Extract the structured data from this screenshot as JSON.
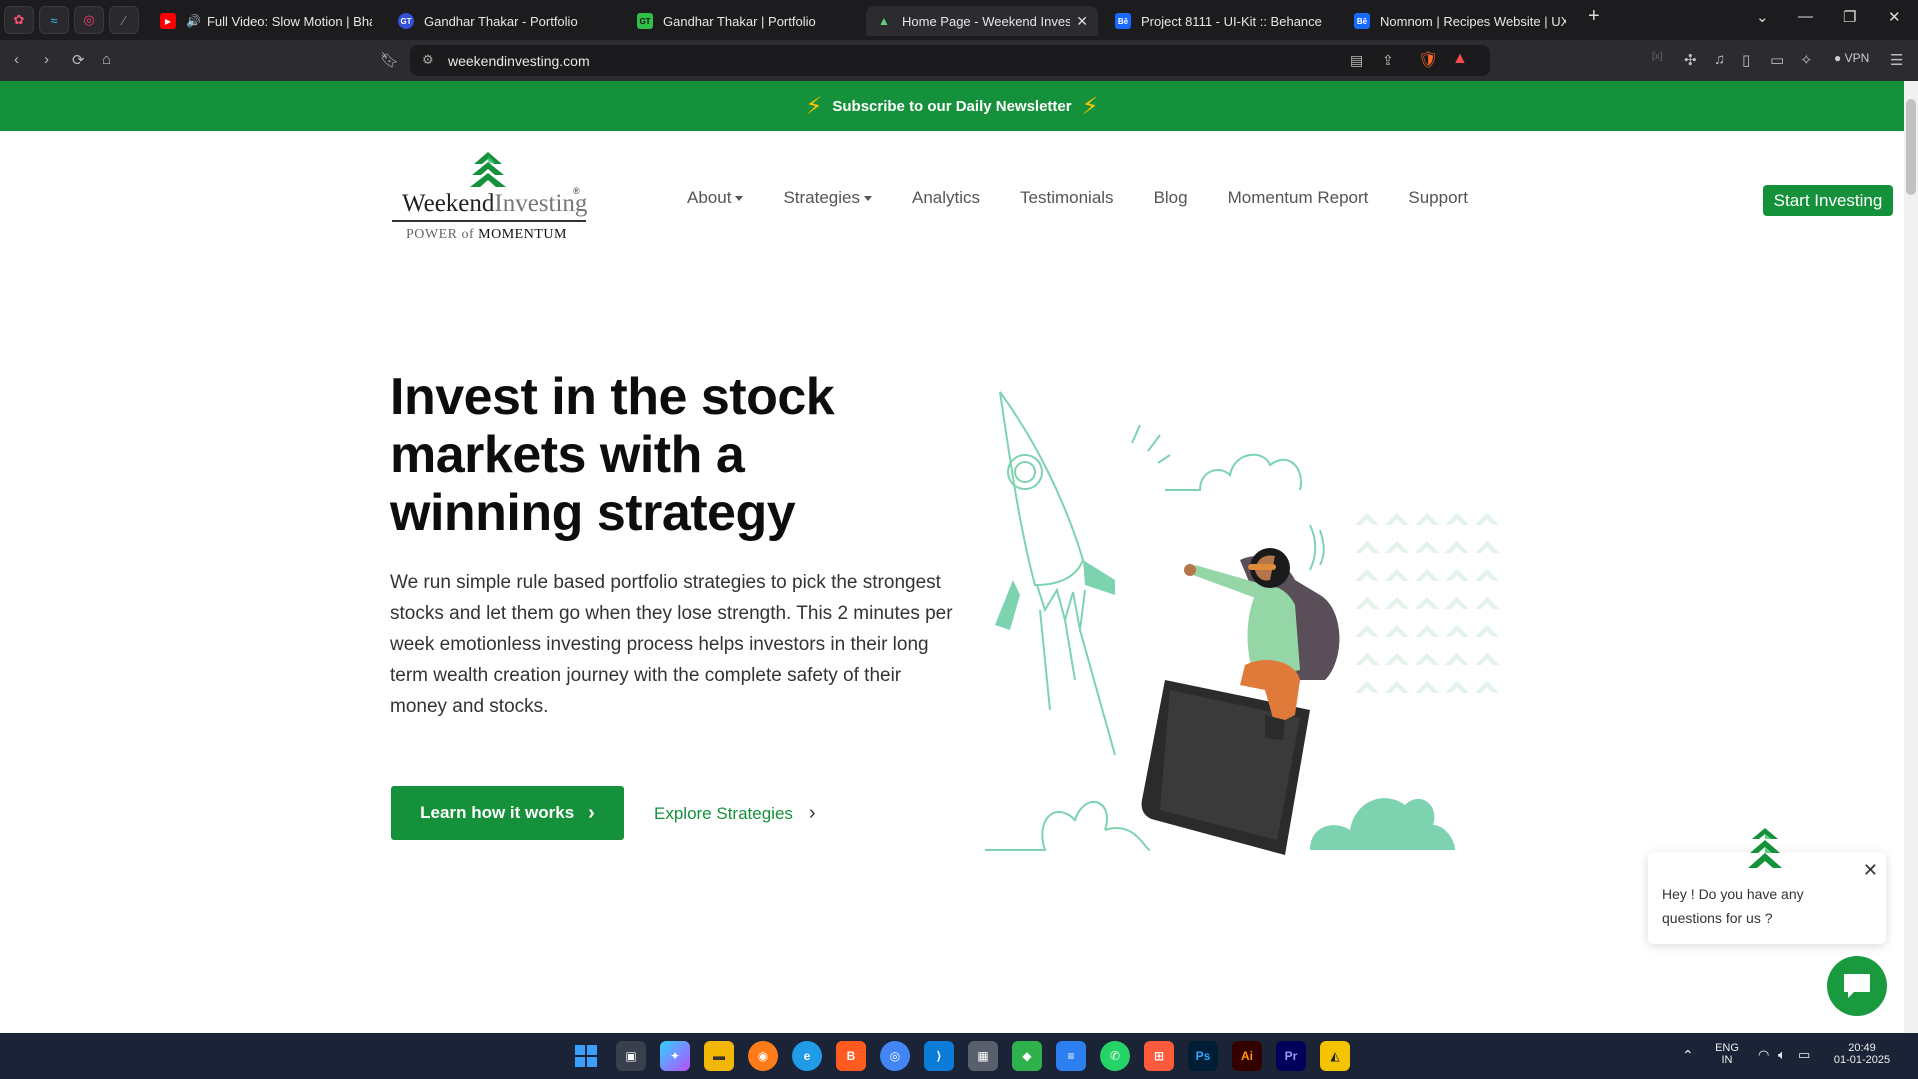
{
  "browser": {
    "tabs": [
      {
        "title": "Full Video: Slow Motion | Bharat",
        "favicon": "youtube-icon",
        "color": "#ff0000"
      },
      {
        "title": "Gandhar Thakar - Portfolio",
        "favicon": "gt-icon",
        "color": "#3550d8"
      },
      {
        "title": "Gandhar Thakar | Portfolio",
        "favicon": "gt-green-icon",
        "color": "#2fc04a"
      },
      {
        "title": "Home Page - Weekend Investing",
        "favicon": "weekend-investing-icon",
        "color": "#16913b"
      },
      {
        "title": "Project 8111 - UI-Kit :: Behance",
        "favicon": "behance-icon",
        "color": "#1769ff"
      },
      {
        "title": "Nomnom | Recipes Website | UX/UI",
        "favicon": "behance-icon",
        "color": "#1769ff"
      }
    ],
    "address": "weekendinvesting.com",
    "vpn_label": "VPN"
  },
  "page": {
    "newsletter": "Subscribe to our Daily Newsletter",
    "logo": {
      "word1": "Weekend",
      "word2": "Investing",
      "reg": "®",
      "tag1": "POWER of ",
      "tag2": "MOMENTUM"
    },
    "nav": [
      "About",
      "Strategies",
      "Analytics",
      "Testimonials",
      "Blog",
      "Momentum Report",
      "Support"
    ],
    "start_button": "Start Investing",
    "hero": {
      "title": "Invest in the stock markets with a winning strategy",
      "description": "We run simple rule based portfolio strategies to pick the strongest stocks and let them go when they lose strength. This 2 minutes per week emotionless investing process helps investors in their long term wealth creation journey with the complete safety of their money and stocks.",
      "primary_cta": "Learn how it works",
      "secondary_cta": "Explore Strategies"
    },
    "chat": {
      "message": "Hey ! Do you have any questions for us ?"
    }
  },
  "taskbar": {
    "lang": "ENG",
    "region": "IN",
    "time": "20:49",
    "date": "01-01-2025"
  },
  "colors": {
    "brand_green": "#16913b",
    "accent_yellow": "#ffc400",
    "illustration_mint": "#7dd3b0"
  }
}
